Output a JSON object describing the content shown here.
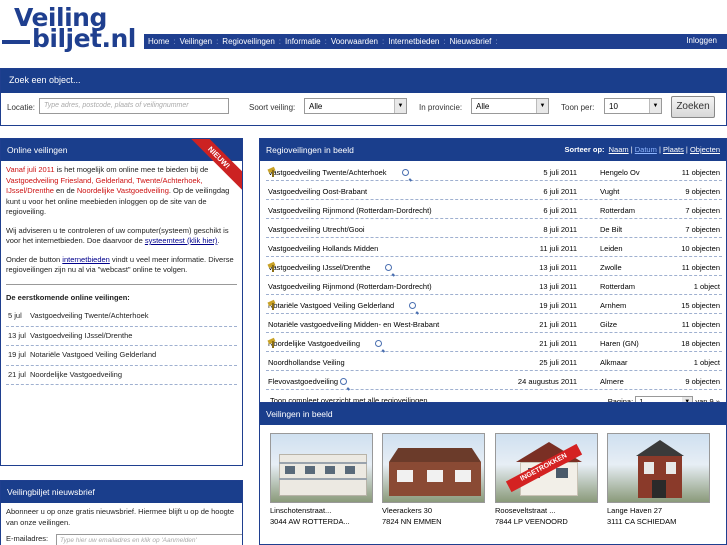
{
  "logo": {
    "line1": "Veiling",
    "line2": "biljet.nl"
  },
  "nav": {
    "items": [
      "Home",
      "Veilingen",
      "Regioveilingen",
      "Informatie",
      "Voorwaarden",
      "Internetbieden",
      "Nieuwsbrief"
    ],
    "login": "Inloggen"
  },
  "search": {
    "header": "Zoek een object...",
    "location_label": "Locatie:",
    "location_placeholder": "Type adres, postcode, plaats of veilingnummer",
    "type_label": "Soort veiling:",
    "type_value": "Alle",
    "province_label": "In provincie:",
    "province_value": "Alle",
    "show_label": "Toon per:",
    "show_value": "10",
    "button": "Zoeken"
  },
  "online": {
    "header": "Online veilingen",
    "ribbon": "NIEUW!",
    "p1_a": "Vanaf juli 2011",
    "p1_b": " is het mogelijk om online mee te bieden bij de ",
    "p1_c": "Vastgoedveiling Friesland, Gelderland, Twente/Achterhoek, IJssel/Drenthe",
    "p1_d": " en de ",
    "p1_e": "Noordelijke Vastgoedveiling",
    "p1_f": ". Op de veilingdag kunt u voor het online meebieden inloggen op de site van de regioveiling.",
    "p2_a": "Wij adviseren u te controleren of uw computer(systeem) geschikt is voor het internetbieden. Doe daarvoor de ",
    "p2_link": "systeemtest (klik hier)",
    "p2_b": ".",
    "p3_a": "Onder de button ",
    "p3_link": "internetbieden",
    "p3_b": " vindt u veel meer informatie. Diverse regioveilingen zijn nu al via \"webcast\" online te volgen.",
    "upcoming_title": "De eerstkomende online veilingen:",
    "upcoming": [
      {
        "date": "5 jul",
        "name": "Vastgoedveiling Twente/Achterhoek"
      },
      {
        "date": "13 jul",
        "name": "Vastgoedveiling IJssel/Drenthe"
      },
      {
        "date": "19 jul",
        "name": "Notariële Vastgoed Veiling Gelderland"
      },
      {
        "date": "21 jul",
        "name": "Noordelijke Vastgoedveiling"
      }
    ]
  },
  "newsletter": {
    "header": "Veilingbiljet nieuwsbrief",
    "text": "Abonneer u op onze gratis nieuwsbrief. Hiermee blijft u op de hoogte van onze veilingen.",
    "email_label": "E-mailadres:",
    "email_placeholder": "Type hier uw emailadres en klik op 'Aanmelden'"
  },
  "regio": {
    "header": "Regioveilingen in beeld",
    "sort_label": "Sorteer op:",
    "sort_options": [
      "Naam",
      "Datum",
      "Plaats",
      "Objecten"
    ],
    "rows": [
      {
        "name": "Vastgoedveiling Twente/Achterhoek",
        "icons": [
          "hammer-icon",
          "magnifier-icon"
        ],
        "date": "5 juli 2011",
        "place": "Hengelo Ov",
        "objects": "11 objecten"
      },
      {
        "name": "Vastgoedveiling Oost-Brabant",
        "icons": [],
        "date": "6 juli 2011",
        "place": "Vught",
        "objects": "9 objecten"
      },
      {
        "name": "Vastgoedveiling Rijnmond (Rotterdam-Dordrecht)",
        "icons": [],
        "date": "6 juli 2011",
        "place": "Rotterdam",
        "objects": "7 objecten"
      },
      {
        "name": "Vastgoedveiling Utrecht/Gooi",
        "icons": [],
        "date": "8 juli 2011",
        "place": "De Bilt",
        "objects": "7 objecten"
      },
      {
        "name": "Vastgoedveiling Hollands Midden",
        "icons": [],
        "date": "11 juli 2011",
        "place": "Leiden",
        "objects": "10 objecten"
      },
      {
        "name": "Vastgoedveiling IJssel/Drenthe",
        "icons": [
          "hammer-icon",
          "magnifier-icon"
        ],
        "date": "13 juli 2011",
        "place": "Zwolle",
        "objects": "11 objecten"
      },
      {
        "name": "Vastgoedveiling Rijnmond (Rotterdam-Dordrecht)",
        "icons": [],
        "date": "13 juli 2011",
        "place": "Rotterdam",
        "objects": "1 object"
      },
      {
        "name": "Notariële Vastgoed Veiling Gelderland",
        "icons": [
          "hammer-icon",
          "magnifier-icon"
        ],
        "date": "19 juli 2011",
        "place": "Arnhem",
        "objects": "15 objecten"
      },
      {
        "name": "Notariële vastgoedveiling Midden- en West-Brabant",
        "icons": [],
        "date": "21 juli 2011",
        "place": "Gilze",
        "objects": "11 objecten"
      },
      {
        "name": "Noordelijke Vastgoedveiling",
        "icons": [
          "hammer-icon",
          "magnifier-icon"
        ],
        "date": "21 juli 2011",
        "place": "Haren (GN)",
        "objects": "18 objecten"
      },
      {
        "name": "Noordhollandse Veiling",
        "icons": [],
        "date": "25 juli 2011",
        "place": "Alkmaar",
        "objects": "1 object"
      },
      {
        "name": "Flevovastgoedveiling",
        "icons": [
          "magnifier-icon"
        ],
        "date": "24 augustus 2011",
        "place": "Almere",
        "objects": "9 objecten"
      }
    ],
    "overview_link": "Toon compleet overzicht met alle regioveilingen",
    "page_label": "Pagina:",
    "page_value": "1",
    "page_total": "van 9",
    "next": "»"
  },
  "veilingen": {
    "header": "Veilingen in beeld",
    "items": [
      {
        "street": "Linschotenstraat...",
        "city": "3044 AW ROTTERDA..."
      },
      {
        "street": "Vleerackers 30",
        "city": "7824 NN EMMEN"
      },
      {
        "street": "Rooseveltstraat ...",
        "city": "7844 LP VEENOORD",
        "stamp": "INGETROKKEN"
      },
      {
        "street": "Lange Haven 27",
        "city": "3111 CA SCHIEDAM"
      }
    ]
  }
}
